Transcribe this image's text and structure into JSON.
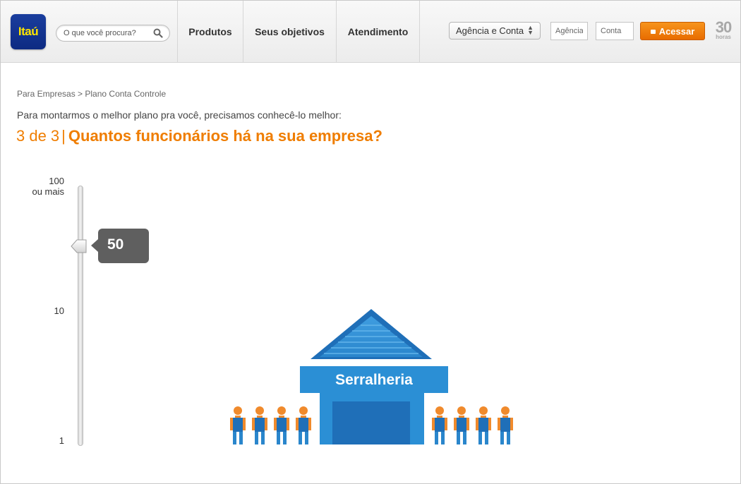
{
  "header": {
    "logo_text": "Itaú",
    "search": {
      "placeholder": "O que você procura?"
    },
    "nav": [
      "Produtos",
      "Seus objetivos",
      "Atendimento"
    ],
    "account_select": {
      "value": "Agência e Conta"
    },
    "agency_field": {
      "placeholder": "Agência"
    },
    "account_field": {
      "placeholder": "Conta"
    },
    "login_button": "Acessar",
    "badge": {
      "number": "30",
      "text": "horas"
    }
  },
  "content": {
    "breadcrumb": "Para Empresas > Plano Conta Controle",
    "subtitle": "Para montarmos o melhor plano pra você, precisamos conhecê-lo melhor:",
    "step": "3 de 3",
    "separator": "|",
    "question": "Quantos funcionários há na sua empresa?"
  },
  "slider": {
    "labels": {
      "top": "100\nou mais",
      "middle": "10",
      "bottom": "1"
    },
    "value": "50"
  },
  "scene": {
    "building_label": "Serralheria",
    "people_count": 8
  },
  "colors": {
    "brand_orange": "#ef7d00",
    "brand_blue": "#1a3e9e",
    "brand_yellow": "#ffe600",
    "building_blue": "#1f7ec5",
    "person_orange": "#f08a2c"
  },
  "icons": [
    "search-icon",
    "lock-icon",
    "slider-thumb-icon"
  ]
}
